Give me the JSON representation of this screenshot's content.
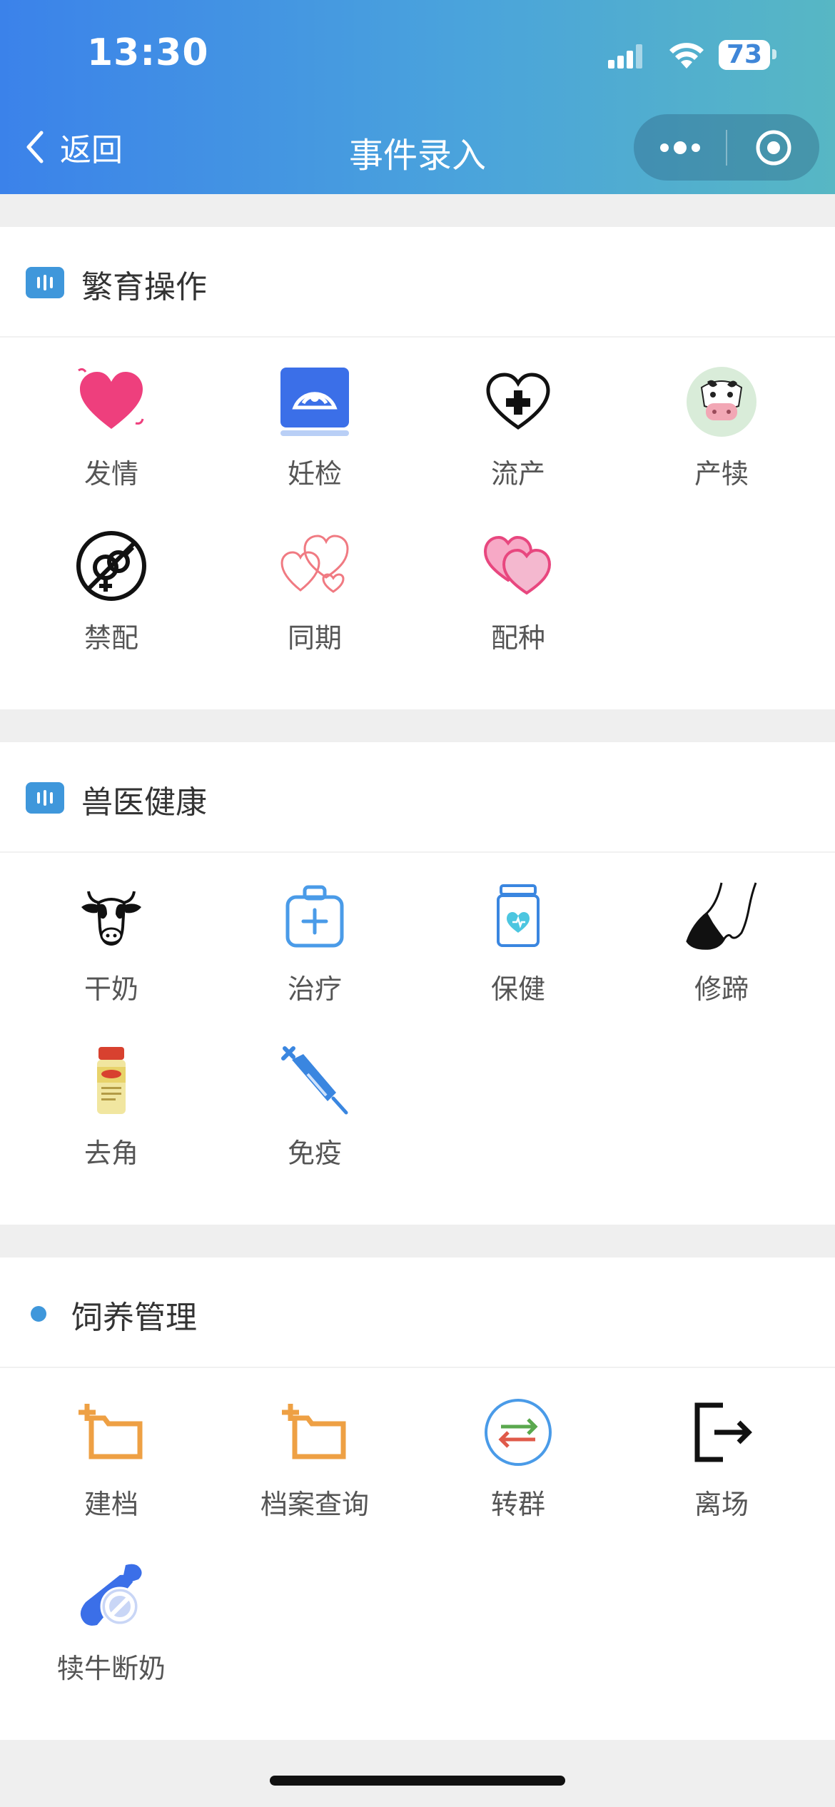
{
  "status_bar": {
    "time": "13:30",
    "battery": "73"
  },
  "nav": {
    "back_label": "返回",
    "title": "事件录入"
  },
  "sections": [
    {
      "title": "繁育操作",
      "items": [
        {
          "label": "发情",
          "icon": "heart-icon"
        },
        {
          "label": "妊检",
          "icon": "ultrasound-icon"
        },
        {
          "label": "流产",
          "icon": "heart-cross-icon"
        },
        {
          "label": "产犊",
          "icon": "calf-face-icon"
        },
        {
          "label": "禁配",
          "icon": "no-mating-icon"
        },
        {
          "label": "同期",
          "icon": "double-heart-outline-icon"
        },
        {
          "label": "配种",
          "icon": "double-heart-icon"
        }
      ]
    },
    {
      "title": "兽医健康",
      "items": [
        {
          "label": "干奶",
          "icon": "cow-head-icon"
        },
        {
          "label": "治疗",
          "icon": "medical-kit-icon"
        },
        {
          "label": "保健",
          "icon": "medicine-jar-icon"
        },
        {
          "label": "修蹄",
          "icon": "hoof-icon"
        },
        {
          "label": "去角",
          "icon": "dehorning-bottle-icon"
        },
        {
          "label": "免疫",
          "icon": "syringe-icon"
        }
      ]
    },
    {
      "title": "饲养管理",
      "items": [
        {
          "label": "建档",
          "icon": "add-folder-icon"
        },
        {
          "label": "档案查询",
          "icon": "folder-search-icon"
        },
        {
          "label": "转群",
          "icon": "transfer-icon"
        },
        {
          "label": "离场",
          "icon": "exit-icon"
        },
        {
          "label": "犊牛断奶",
          "icon": "weaning-icon"
        }
      ]
    }
  ]
}
